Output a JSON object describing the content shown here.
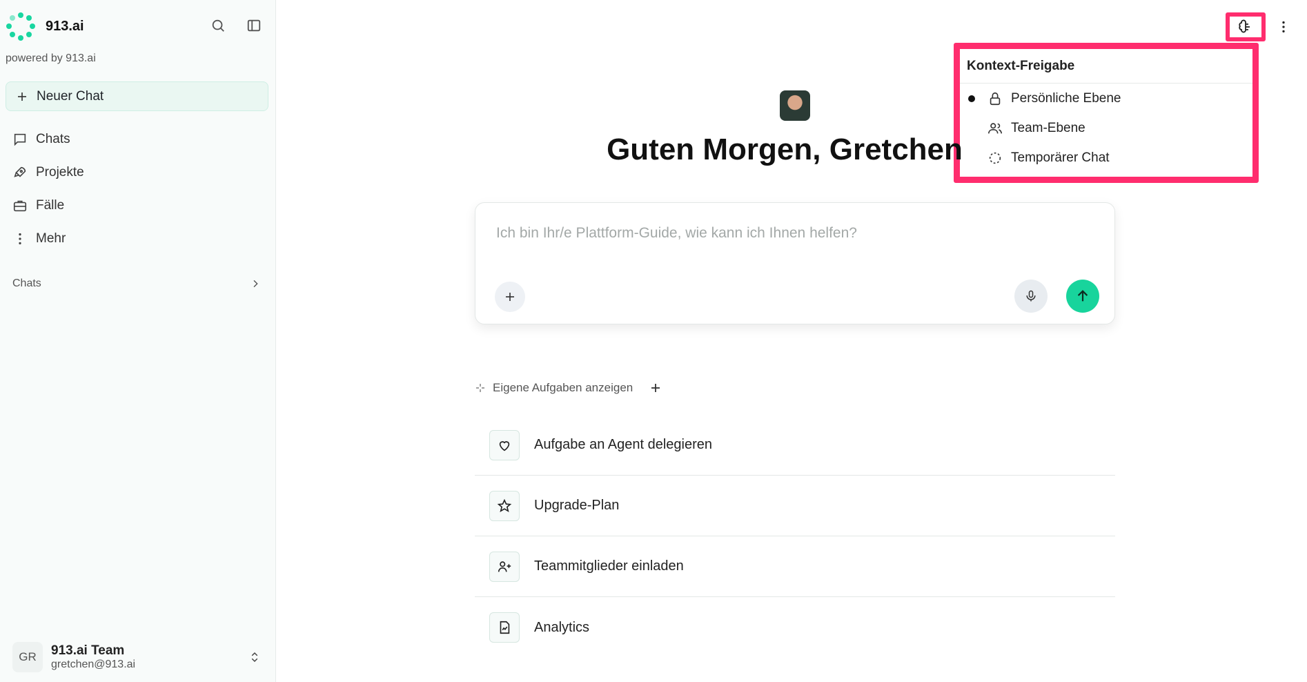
{
  "brand": {
    "name": "913.ai",
    "powered": "powered by 913.ai",
    "accent": "#19d6a0"
  },
  "sidebar": {
    "new_chat": "Neuer Chat",
    "items": [
      {
        "label": "Chats",
        "icon": "chat-bubble-icon"
      },
      {
        "label": "Projekte",
        "icon": "rocket-icon"
      },
      {
        "label": "Fälle",
        "icon": "briefcase-icon"
      },
      {
        "label": "Mehr",
        "icon": "more-vertical-icon"
      }
    ],
    "section_label": "Chats"
  },
  "user": {
    "initials": "GR",
    "name": "913.ai Team",
    "email": "gretchen@913.ai"
  },
  "context_menu": {
    "title": "Kontext-Freigabe",
    "items": [
      {
        "label": "Persönliche Ebene",
        "selected": true,
        "icon": "lock-icon"
      },
      {
        "label": "Team-Ebene",
        "selected": false,
        "icon": "users-icon"
      },
      {
        "label": "Temporärer Chat",
        "selected": false,
        "icon": "dashed-circle-icon"
      }
    ],
    "highlight_color": "#ff2d6e"
  },
  "main": {
    "greeting": "Guten Morgen, Gretchen",
    "composer_placeholder": "Ich bin Ihr/e Plattform-Guide, wie kann ich Ihnen helfen?",
    "tasks_header": "Eigene Aufgaben anzeigen",
    "tasks": [
      {
        "label": "Aufgabe an Agent delegieren",
        "icon": "heart-icon"
      },
      {
        "label": "Upgrade-Plan",
        "icon": "star-icon"
      },
      {
        "label": "Teammitglieder einladen",
        "icon": "user-plus-icon"
      },
      {
        "label": "Analytics",
        "icon": "file-chart-icon"
      }
    ]
  }
}
